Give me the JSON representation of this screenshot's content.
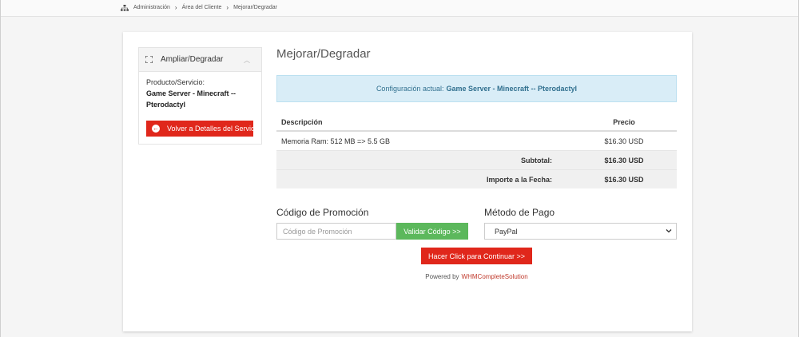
{
  "breadcrumb": {
    "items": [
      "Administración",
      "Área del Cliente",
      "Mejorar/Degradar"
    ],
    "separator": "›"
  },
  "sidebar": {
    "title": "Ampliar/Degradar",
    "product_label": "Producto/Servicio:",
    "product_name": "Game Server - Minecraft -- Pterodactyl",
    "back_button": "Volver a Detalles del Servicio"
  },
  "main": {
    "title": "Mejorar/Degradar",
    "current_config_label": "Configuración actual:",
    "current_config_value": "Game Server - Minecraft -- Pterodactyl"
  },
  "table": {
    "headers": [
      "Descripción",
      "Precio"
    ],
    "rows": [
      {
        "description": "Memoria Ram: 512 MB => 5.5 GB",
        "price": "$16.30 USD"
      }
    ],
    "subtotal_label": "Subtotal:",
    "subtotal_value": "$16.30 USD",
    "due_today_label": "Importe a la Fecha:",
    "due_today_value": "$16.30 USD"
  },
  "promo": {
    "label": "Código de Promoción",
    "placeholder": "Código de Promoción",
    "button": "Validar Código >>"
  },
  "payment": {
    "label": "Método de Pago",
    "selected": "PayPal"
  },
  "continue_button": "Hacer Click para Continuar >>",
  "footer": {
    "powered_by": "Powered by",
    "link": "WHMCompleteSolution"
  },
  "colors": {
    "accent_red": "#e0271b",
    "success_green": "#5cb85c",
    "info_bg": "#d9edf7",
    "info_text": "#31708f"
  }
}
